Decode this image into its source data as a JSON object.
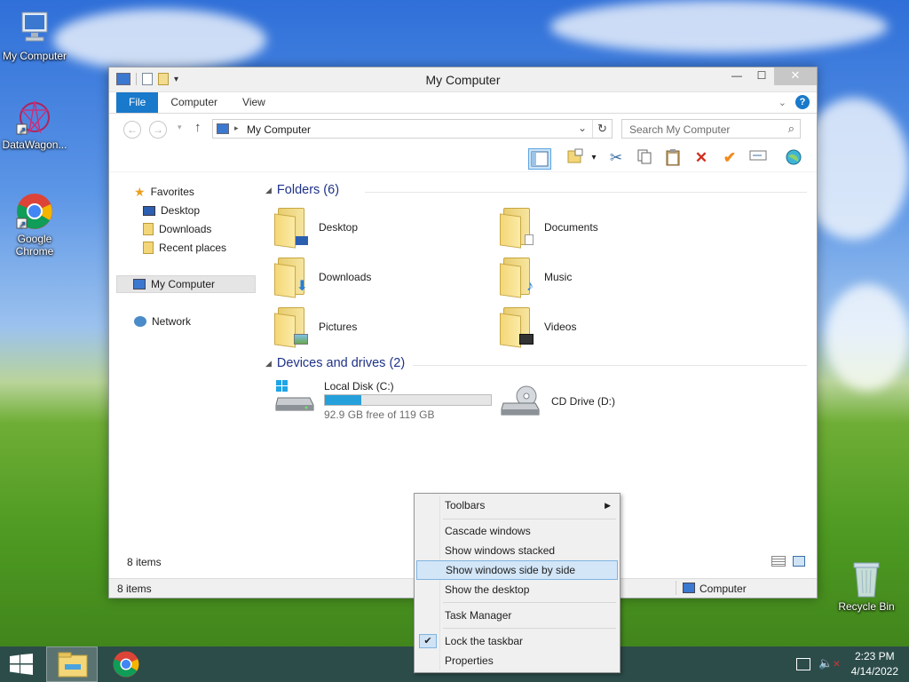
{
  "desktop": {
    "icons": [
      {
        "label": "My Computer"
      },
      {
        "label": "DataWagon..."
      },
      {
        "label": "Google Chrome"
      },
      {
        "label": "Recycle Bin"
      }
    ]
  },
  "window": {
    "title": "My Computer",
    "tabs": [
      {
        "label": "File"
      },
      {
        "label": "Computer"
      },
      {
        "label": "View"
      }
    ],
    "address": "My Computer",
    "search_placeholder": "Search My Computer",
    "navpane": {
      "favorites": "Favorites",
      "desktop": "Desktop",
      "downloads": "Downloads",
      "recent": "Recent places",
      "computer": "My Computer",
      "network": "Network"
    },
    "folders_header": "Folders (6)",
    "folders": [
      {
        "label": "Desktop"
      },
      {
        "label": "Documents"
      },
      {
        "label": "Downloads"
      },
      {
        "label": "Music"
      },
      {
        "label": "Pictures"
      },
      {
        "label": "Videos"
      }
    ],
    "drives_header": "Devices and drives (2)",
    "drives": [
      {
        "label": "Local Disk (C:)",
        "free_text": "92.9 GB free of 119 GB",
        "used_fraction": 0.22
      },
      {
        "label": "CD Drive (D:)"
      }
    ],
    "items_count": "8 items",
    "status_items": "8 items",
    "status_location": "Computer"
  },
  "context_menu": {
    "items": [
      {
        "label": "Toolbars"
      },
      {
        "label": "Cascade windows"
      },
      {
        "label": "Show windows stacked"
      },
      {
        "label": "Show windows side by side"
      },
      {
        "label": "Show the desktop"
      },
      {
        "label": "Task Manager"
      },
      {
        "label": "Lock the taskbar"
      },
      {
        "label": "Properties"
      }
    ]
  },
  "taskbar": {
    "time": "2:23 PM",
    "date": "4/14/2022"
  },
  "colors": {
    "accent": "#1979ca",
    "highlight": "#d3e6f7",
    "progress": "#26a0da"
  }
}
